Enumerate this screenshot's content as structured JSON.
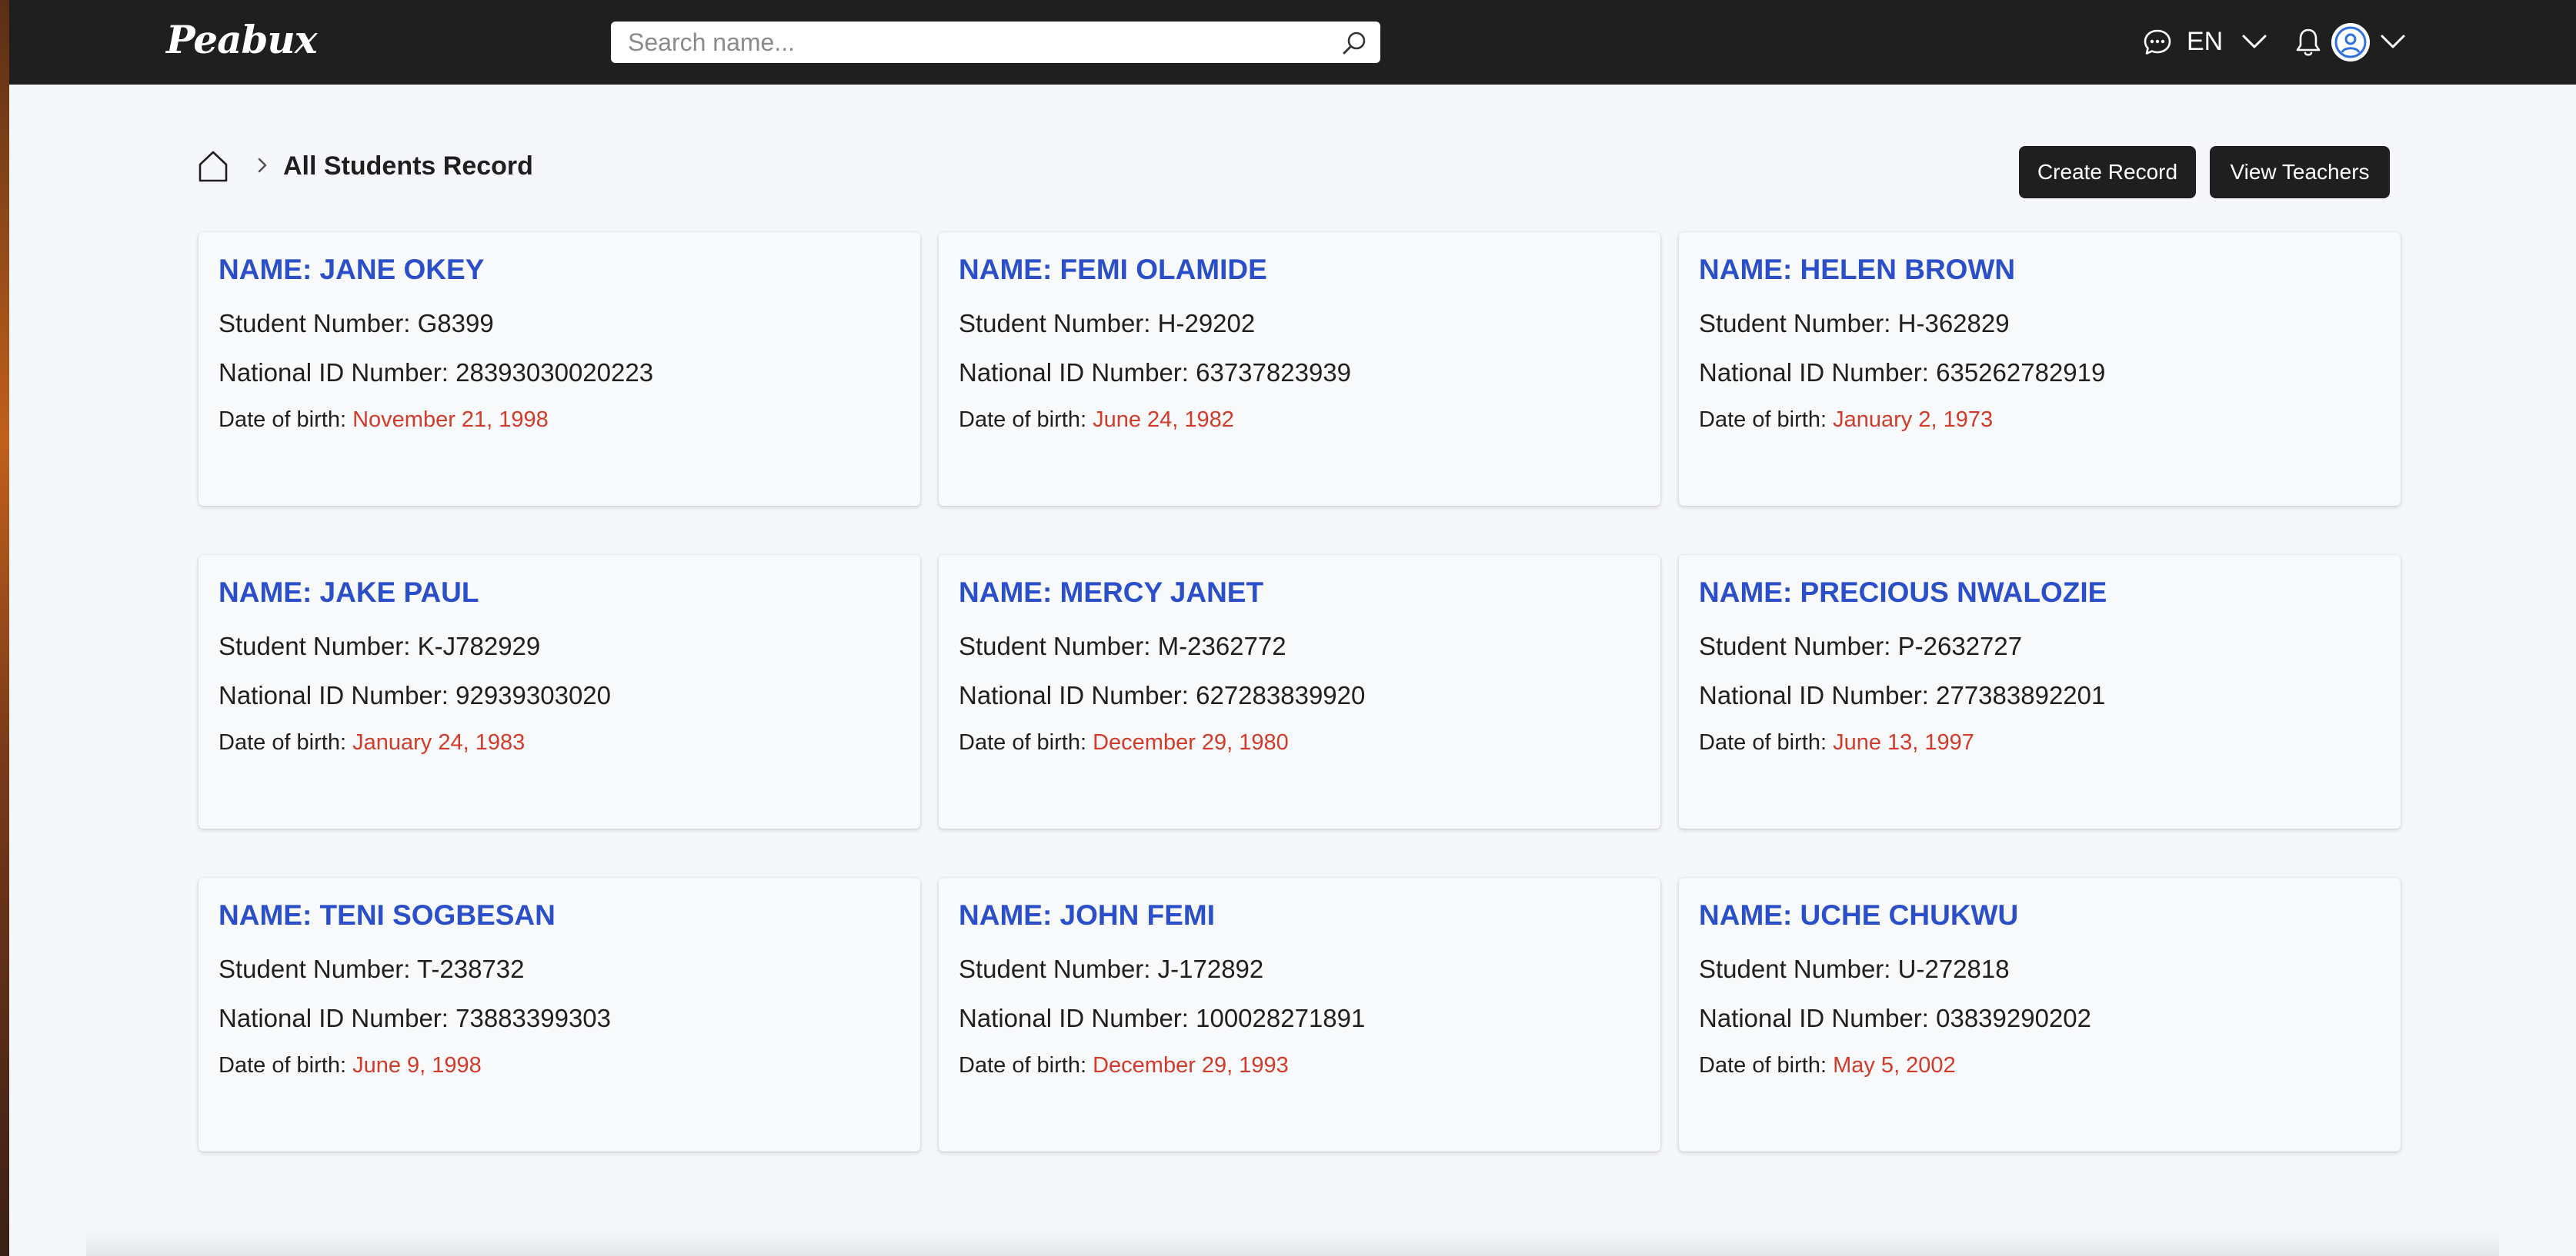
{
  "app": {
    "logo": "Peabux"
  },
  "navbar": {
    "search": {
      "placeholder": "Search name...",
      "value": ""
    },
    "language": "EN",
    "icons": {
      "search": "search-icon",
      "chat": "chat-icon",
      "language_menu": "chevron-down-icon",
      "notifications": "bell-icon",
      "avatar": "user-circle-icon",
      "account_menu": "chevron-down-icon"
    }
  },
  "breadcrumb": {
    "home_icon": "home-icon",
    "separator_icon": "chevron-right-icon",
    "title": "All Students Record"
  },
  "actions": {
    "create_label": "Create Record",
    "teachers_label": "View Teachers"
  },
  "labels": {
    "student_number": "Student Number: ",
    "national_id": "National ID Number: ",
    "dob": "Date of birth: "
  },
  "students": [
    {
      "name": "NAME: JANE OKEY",
      "student_number": "G8399",
      "national_id": "28393030020223",
      "dob": "November 21, 1998"
    },
    {
      "name": "NAME: FEMI OLAMIDE",
      "student_number": "H-29202",
      "national_id": "63737823939",
      "dob": "June 24, 1982"
    },
    {
      "name": "NAME: HELEN BROWN",
      "student_number": "H-362829",
      "national_id": "635262782919",
      "dob": "January 2, 1973"
    },
    {
      "name": "NAME: JAKE PAUL",
      "student_number": "K-J782929",
      "national_id": "92939303020",
      "dob": "January 24, 1983"
    },
    {
      "name": "NAME: MERCY JANET",
      "student_number": "M-2362772",
      "national_id": "627283839920",
      "dob": "December 29, 1980"
    },
    {
      "name": "NAME: PRECIOUS NWALOZIE",
      "student_number": "P-2632727",
      "national_id": "277383892201",
      "dob": "June 13, 1997"
    },
    {
      "name": "NAME: TENI SOGBESAN",
      "student_number": "T-238732",
      "national_id": "73883399303",
      "dob": "June 9, 1998"
    },
    {
      "name": "NAME: JOHN FEMI",
      "student_number": "J-172892",
      "national_id": "100028271891",
      "dob": "December 29, 1993"
    },
    {
      "name": "NAME: UCHE CHUKWU",
      "student_number": "U-272818",
      "national_id": "03839290202",
      "dob": "May 5, 2002"
    }
  ],
  "colors": {
    "navbar": "#1f1f1f",
    "name_accent": "#2b4fc8",
    "date_accent": "#d23b2a",
    "page_background": "#f5f7fa"
  }
}
